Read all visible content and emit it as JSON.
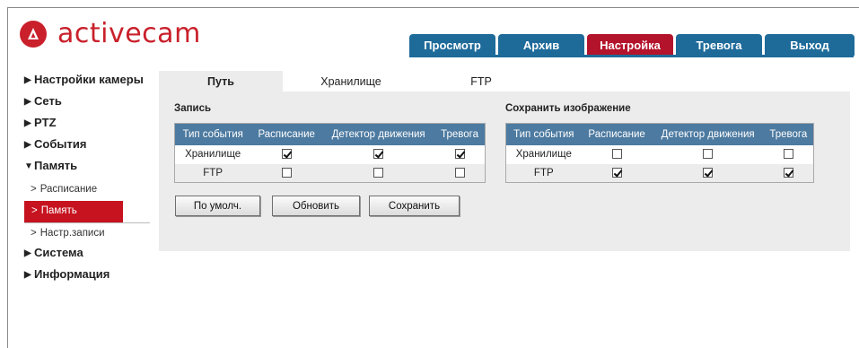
{
  "brand": {
    "name": "activecam",
    "color": "#c9202b",
    "icon": "activecam-logo-icon"
  },
  "topnav": {
    "tabs": [
      {
        "label": "Просмотр",
        "active": false
      },
      {
        "label": "Архив",
        "active": false
      },
      {
        "label": "Настройка",
        "active": true
      },
      {
        "label": "Тревога",
        "active": false
      },
      {
        "label": "Выход",
        "active": false
      }
    ],
    "colors": {
      "tab": "#1e6b9a",
      "active": "#b3142c"
    }
  },
  "sidebar": {
    "items": [
      {
        "label": "Настройки камеры",
        "arrow": "▶"
      },
      {
        "label": "Сеть",
        "arrow": "▶"
      },
      {
        "label": "PTZ",
        "arrow": "▶"
      },
      {
        "label": "События",
        "arrow": "▶"
      },
      {
        "label": "Память",
        "arrow": "▼"
      },
      {
        "label": "Система",
        "arrow": "▶"
      },
      {
        "label": "Информация",
        "arrow": "▶"
      }
    ],
    "subitems": [
      {
        "label": "Расписание",
        "carat": ">",
        "active": false
      },
      {
        "label": "Память",
        "carat": ">",
        "active": true
      },
      {
        "label": "Настр.записи",
        "carat": ">",
        "active": false
      }
    ]
  },
  "subtabs": [
    {
      "label": "Путь",
      "active": true
    },
    {
      "label": "Хранилище",
      "active": false
    },
    {
      "label": "FTP",
      "active": false
    }
  ],
  "record": {
    "title": "Запись",
    "headers": [
      "Тип события",
      "Расписание",
      "Детектор движения",
      "Тревога"
    ],
    "rows": [
      {
        "label": "Хранилище",
        "checks": [
          true,
          true,
          true
        ]
      },
      {
        "label": "FTP",
        "checks": [
          false,
          false,
          false
        ]
      }
    ]
  },
  "snapshot": {
    "title": "Сохранить изображение",
    "headers": [
      "Тип события",
      "Расписание",
      "Детектор движения",
      "Тревога"
    ],
    "rows": [
      {
        "label": "Хранилище",
        "checks": [
          false,
          false,
          false
        ]
      },
      {
        "label": "FTP",
        "checks": [
          true,
          true,
          true
        ]
      }
    ]
  },
  "buttons": {
    "default": "По умолч.",
    "refresh": "Обновить",
    "save": "Сохранить"
  }
}
